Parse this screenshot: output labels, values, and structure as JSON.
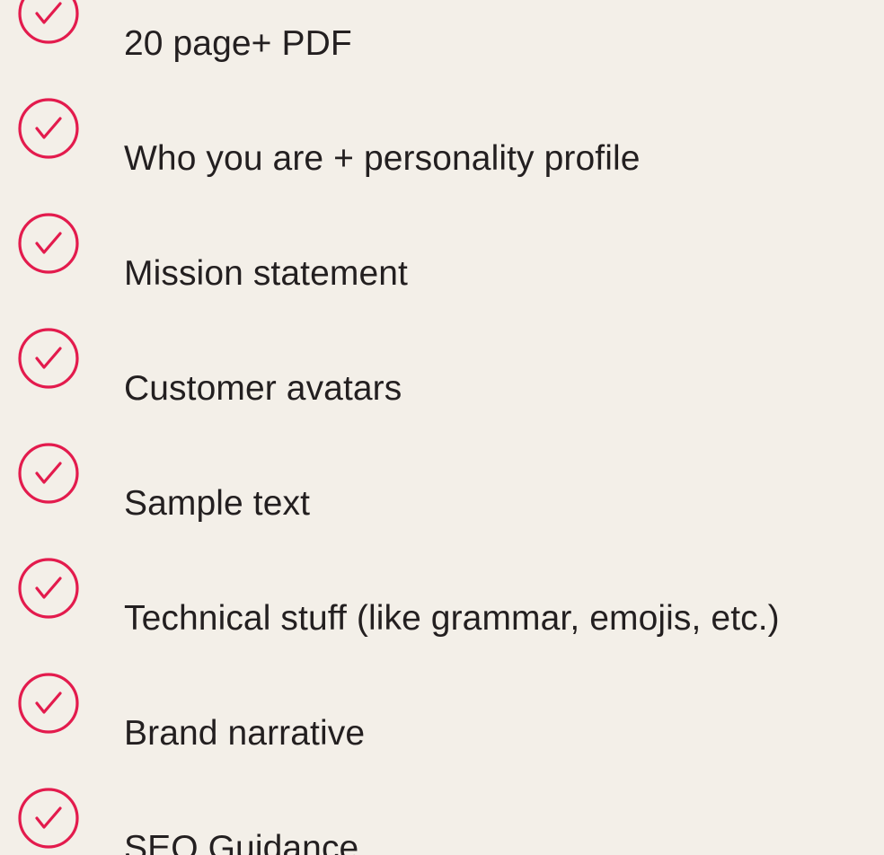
{
  "accent": "#e31b4d",
  "items": [
    {
      "label": "20 page+ PDF",
      "icon": "check-circle-icon"
    },
    {
      "label": "Who you are + personality profile",
      "icon": "check-circle-icon"
    },
    {
      "label": "Mission statement",
      "icon": "check-circle-icon"
    },
    {
      "label": "Customer avatars",
      "icon": "check-circle-icon"
    },
    {
      "label": "Sample text",
      "icon": "check-circle-icon"
    },
    {
      "label": "Technical stuff (like grammar, emojis, etc.)",
      "icon": "check-circle-icon"
    },
    {
      "label": "Brand narrative",
      "icon": "check-circle-icon"
    },
    {
      "label": "SEO Guidance",
      "icon": "check-circle-icon"
    }
  ]
}
